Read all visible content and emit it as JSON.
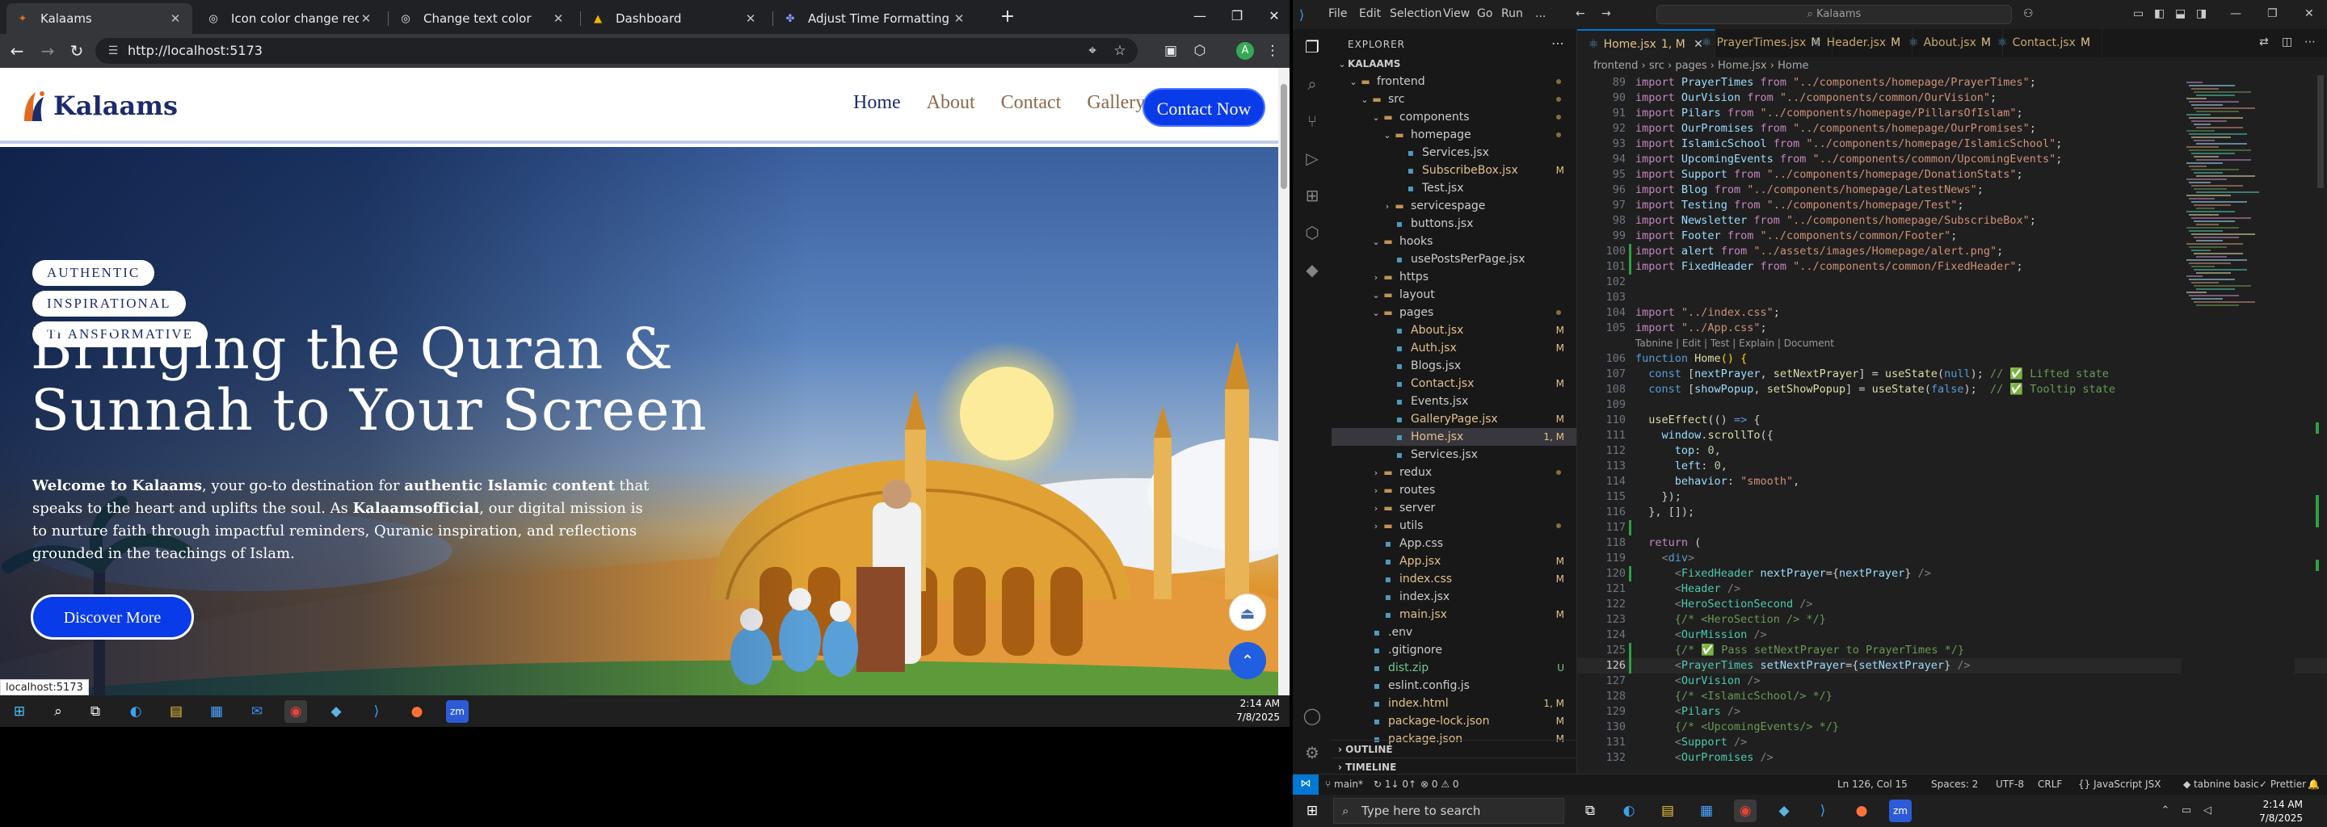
{
  "browser": {
    "tabs": [
      {
        "title": "Kalaams",
        "icon": "kalaams-favicon",
        "active": true
      },
      {
        "title": "Icon color change request",
        "icon": "chatgpt-favicon"
      },
      {
        "title": "Change text color",
        "icon": "chatgpt-favicon"
      },
      {
        "title": "Dashboard",
        "icon": "dashboard-favicon"
      },
      {
        "title": "Adjust Time Formatting for AM/PM",
        "icon": "ai-favicon"
      }
    ],
    "url": "http://localhost:5173",
    "status_url": "localhost:5173"
  },
  "site": {
    "logo_text": "Kalaams",
    "nav": [
      "Home",
      "About",
      "Contact",
      "Gallery"
    ],
    "cta": "Contact Now",
    "pills": [
      "AUTHENTIC",
      "INSPIRATIONAL",
      "TRANSFORMATIVE"
    ],
    "hero_title_line1": "Bringing the Quran &",
    "hero_title_line2": "Sunnah to Your Screen",
    "hero_desc": {
      "p1": "Welcome to Kalaams",
      "p2": ", your go-to destination for ",
      "p3": "authentic Islamic content",
      "p4": " that speaks to the heart and uplifts the soul. As ",
      "p5": "Kalaamsofficial",
      "p6": ", our digital mission is to nurture faith through impactful reminders, Quranic inspiration, and reflections grounded in the teachings of Islam."
    },
    "discover": "Discover More"
  },
  "taskbar_left": {
    "time": "2:14 AM",
    "date": "7/8/2025"
  },
  "vscode": {
    "menu": [
      "File",
      "Edit",
      "Selection",
      "View",
      "Go",
      "Run",
      "..."
    ],
    "search": "Kalaams",
    "explorer_title": "EXPLORER",
    "tree": [
      {
        "label": "KALAAMS",
        "depth": 0,
        "kind": "root"
      },
      {
        "label": "frontend",
        "depth": 1,
        "kind": "folder-open",
        "dot": true
      },
      {
        "label": "src",
        "depth": 2,
        "kind": "folder-open",
        "dot": true
      },
      {
        "label": "components",
        "depth": 3,
        "kind": "folder-open",
        "dot": true
      },
      {
        "label": "homepage",
        "depth": 4,
        "kind": "folder-open",
        "dot": true
      },
      {
        "label": "Services.jsx",
        "depth": 5,
        "kind": "file"
      },
      {
        "label": "SubscribeBox.jsx",
        "depth": 5,
        "kind": "file",
        "badge": "M"
      },
      {
        "label": "Test.jsx",
        "depth": 5,
        "kind": "file"
      },
      {
        "label": "servicespage",
        "depth": 4,
        "kind": "folder"
      },
      {
        "label": "buttons.jsx",
        "depth": 4,
        "kind": "file"
      },
      {
        "label": "hooks",
        "depth": 3,
        "kind": "folder-open"
      },
      {
        "label": "usePostsPerPage.jsx",
        "depth": 4,
        "kind": "file"
      },
      {
        "label": "https",
        "depth": 3,
        "kind": "folder"
      },
      {
        "label": "layout",
        "depth": 3,
        "kind": "folder-open"
      },
      {
        "label": "pages",
        "depth": 3,
        "kind": "folder-open",
        "dot": true
      },
      {
        "label": "About.jsx",
        "depth": 4,
        "kind": "file",
        "badge": "M"
      },
      {
        "label": "Auth.jsx",
        "depth": 4,
        "kind": "file",
        "badge": "M"
      },
      {
        "label": "Blogs.jsx",
        "depth": 4,
        "kind": "file"
      },
      {
        "label": "Contact.jsx",
        "depth": 4,
        "kind": "file",
        "badge": "M"
      },
      {
        "label": "Events.jsx",
        "depth": 4,
        "kind": "file"
      },
      {
        "label": "GalleryPage.jsx",
        "depth": 4,
        "kind": "file",
        "badge": "M"
      },
      {
        "label": "Home.jsx",
        "depth": 4,
        "kind": "file",
        "badge": "1, M",
        "selected": true
      },
      {
        "label": "Services.jsx",
        "depth": 4,
        "kind": "file"
      },
      {
        "label": "redux",
        "depth": 3,
        "kind": "folder",
        "dot": true
      },
      {
        "label": "routes",
        "depth": 3,
        "kind": "folder"
      },
      {
        "label": "server",
        "depth": 3,
        "kind": "folder"
      },
      {
        "label": "utils",
        "depth": 3,
        "kind": "folder",
        "dot": true
      },
      {
        "label": "App.css",
        "depth": 3,
        "kind": "file"
      },
      {
        "label": "App.jsx",
        "depth": 3,
        "kind": "file",
        "badge": "M"
      },
      {
        "label": "index.css",
        "depth": 3,
        "kind": "file",
        "badge": "M"
      },
      {
        "label": "index.jsx",
        "depth": 3,
        "kind": "file"
      },
      {
        "label": "main.jsx",
        "depth": 3,
        "kind": "file",
        "badge": "M"
      },
      {
        "label": ".env",
        "depth": 2,
        "kind": "file"
      },
      {
        "label": ".gitignore",
        "depth": 2,
        "kind": "file"
      },
      {
        "label": "dist.zip",
        "depth": 2,
        "kind": "file",
        "badge": "U"
      },
      {
        "label": "eslint.config.js",
        "depth": 2,
        "kind": "file"
      },
      {
        "label": "index.html",
        "depth": 2,
        "kind": "file",
        "badge": "1, M"
      },
      {
        "label": "package-lock.json",
        "depth": 2,
        "kind": "file",
        "badge": "M"
      },
      {
        "label": "package.json",
        "depth": 2,
        "kind": "file",
        "badge": "M"
      }
    ],
    "outline": "OUTLINE",
    "timeline": "TIMELINE",
    "tabs": [
      {
        "label": "Home.jsx",
        "suffix": "1, M",
        "active": true
      },
      {
        "label": "PrayerTimes.jsx",
        "suffix": "M"
      },
      {
        "label": "Header.jsx",
        "suffix": "M"
      },
      {
        "label": "About.jsx",
        "suffix": "M"
      },
      {
        "label": "Contact.jsx",
        "suffix": "M"
      }
    ],
    "breadcrumb": "frontend › src › pages › Home.jsx › Home",
    "codelens": "Tabnine | Edit | Test | Explain | Document",
    "status": {
      "branch": "main*",
      "sync": "1↓ 0↑",
      "problems": "⊗ 0 ⚠ 0",
      "position": "Ln 126, Col 15",
      "spaces": "Spaces: 2",
      "encoding": "UTF-8",
      "eol": "CRLF",
      "language": "{} JavaScript JSX",
      "tabnine": "tabnine basic",
      "prettier": "✓ Prettier"
    }
  },
  "taskbar_right": {
    "search_placeholder": "Type here to search",
    "time": "2:14 AM",
    "date": "7/8/2025"
  }
}
